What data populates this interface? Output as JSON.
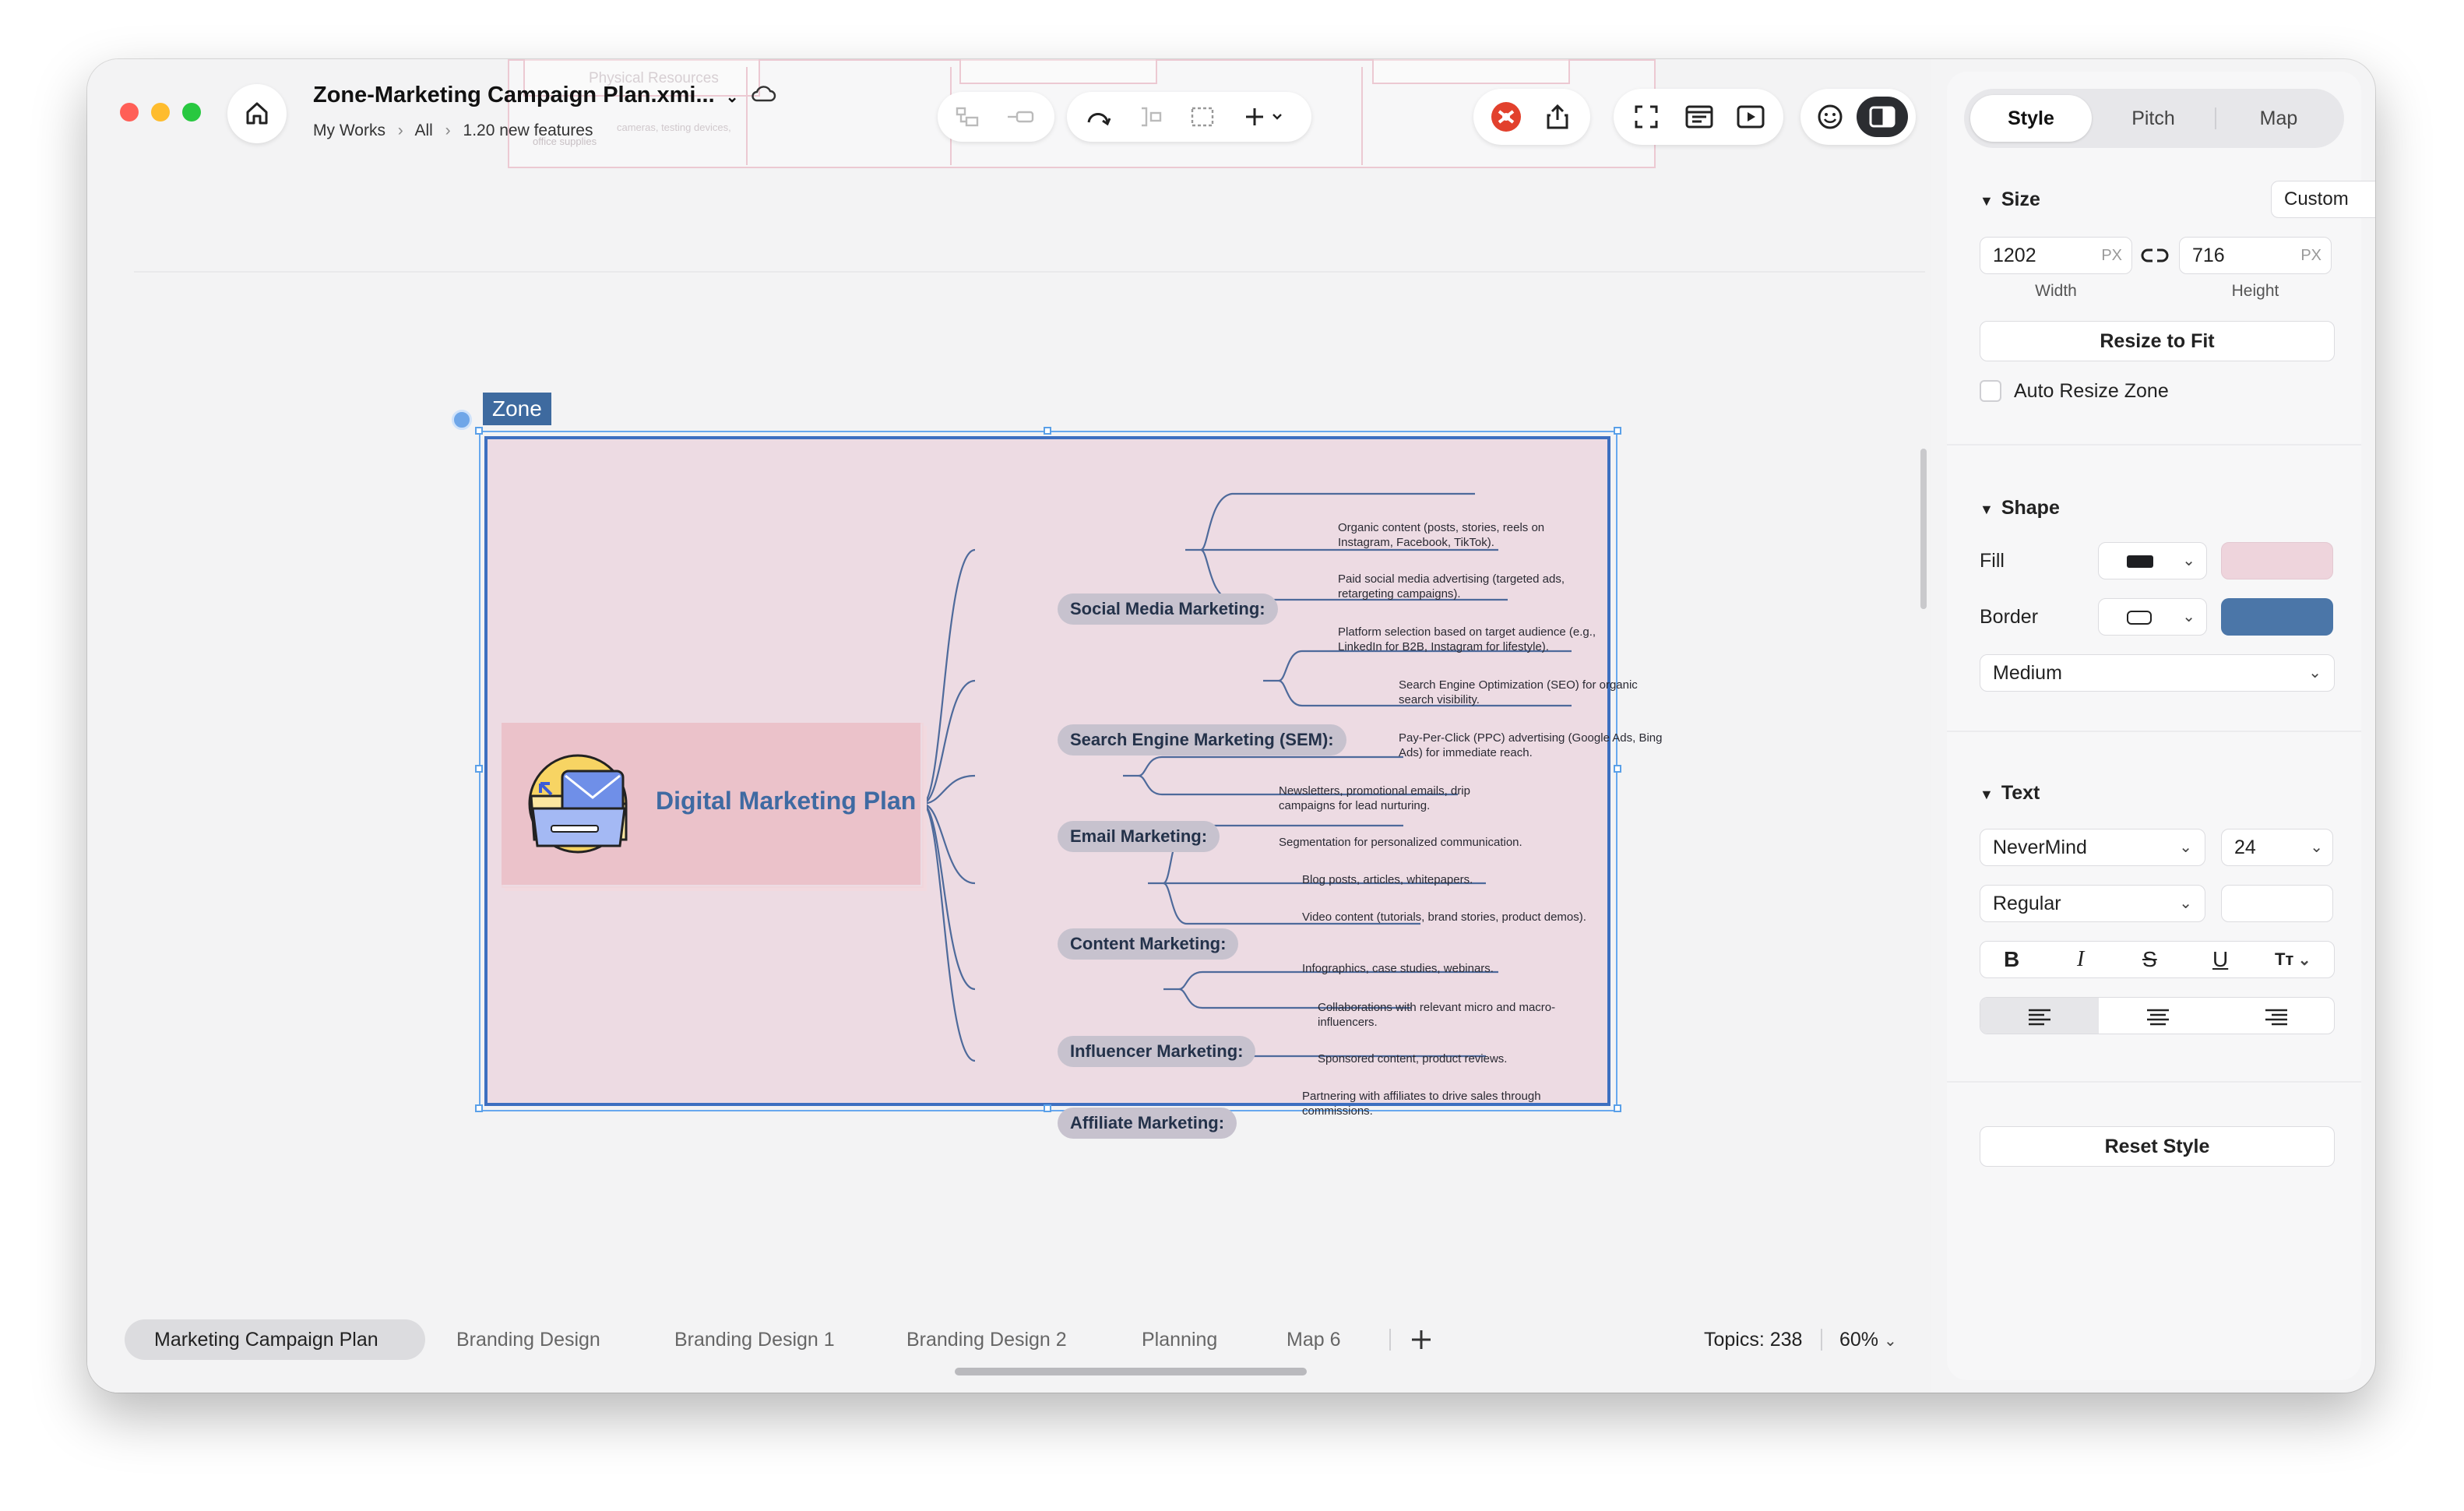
{
  "window": {
    "title": "Zone-Marketing Campaign Plan.xmi...",
    "breadcrumb": [
      "My Works",
      "All",
      "1.20 new features"
    ]
  },
  "ghost_text": {
    "physical": "Physical Resources",
    "office": "office supplies",
    "testing": "cameras, testing devices,"
  },
  "zone": {
    "label": "Zone"
  },
  "map": {
    "central": "Digital Marketing Plan",
    "topics": [
      {
        "label": "Social Media Marketing:",
        "leaves": [
          "Organic content (posts, stories, reels on Instagram, Facebook, TikTok).",
          "Paid social media advertising (targeted ads, retargeting campaigns).",
          "Platform selection based on target audience (e.g., LinkedIn for B2B, Instagram for lifestyle)."
        ]
      },
      {
        "label": "Search Engine Marketing (SEM):",
        "leaves": [
          "Search Engine Optimization (SEO) for organic search visibility.",
          "Pay-Per-Click (PPC) advertising (Google Ads, Bing Ads) for immediate reach."
        ]
      },
      {
        "label": "Email Marketing:",
        "leaves": [
          "Newsletters, promotional emails, drip campaigns for lead nurturing.",
          "Segmentation for personalized communication."
        ]
      },
      {
        "label": "Content Marketing:",
        "leaves": [
          "Blog posts, articles, whitepapers.",
          "Video content (tutorials, brand stories, product demos).",
          "Infographics, case studies, webinars."
        ]
      },
      {
        "label": "Influencer Marketing:",
        "leaves": [
          "Collaborations with relevant micro and macro-influencers.",
          "Sponsored content, product reviews."
        ]
      },
      {
        "label": "Affiliate Marketing:",
        "leaves": [
          "Partnering with affiliates to drive sales through commissions."
        ]
      }
    ]
  },
  "bottom": {
    "sheets": [
      "Marketing Campaign Plan",
      "Branding Design",
      "Branding Design 1",
      "Branding Design 2",
      "Planning",
      "Map 6"
    ],
    "topics": "Topics: 238",
    "zoom": "60%"
  },
  "panel": {
    "tabs": [
      "Style",
      "Pitch",
      "Map"
    ],
    "size": {
      "title": "Size",
      "preset": "Custom",
      "width": "1202",
      "height": "716",
      "unit": "PX",
      "width_label": "Width",
      "height_label": "Height",
      "resize": "Resize to Fit",
      "auto": "Auto Resize Zone"
    },
    "shape": {
      "title": "Shape",
      "fill": "Fill",
      "border": "Border",
      "fill_color": "#eddbe3",
      "border_color": "#4b76a8",
      "weight": "Medium"
    },
    "text": {
      "title": "Text",
      "font": "NeverMind",
      "size": "24",
      "weight": "Regular",
      "color": ""
    },
    "reset": "Reset Style"
  },
  "colors": {
    "accent": "#3d6fc0",
    "zone_fill": "#eddbe3",
    "central_fill": "#ebc2ca"
  }
}
